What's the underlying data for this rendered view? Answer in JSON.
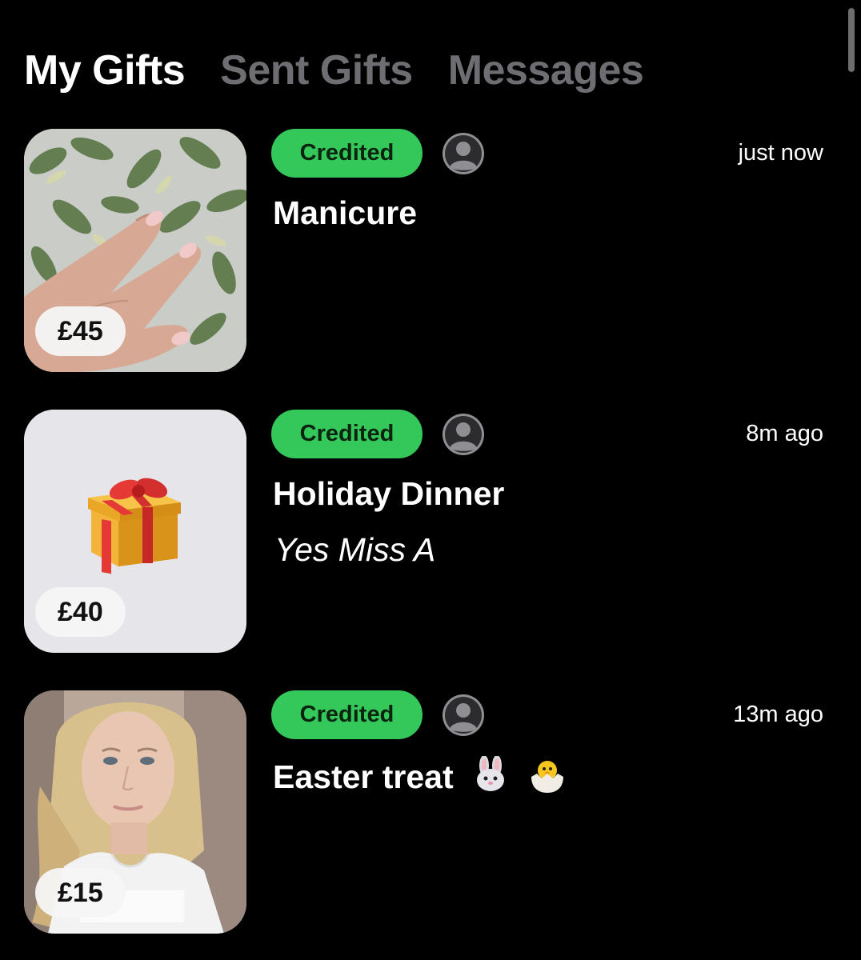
{
  "tabs": [
    {
      "label": "My Gifts",
      "active": true
    },
    {
      "label": "Sent Gifts",
      "active": false
    },
    {
      "label": "Messages",
      "active": false
    }
  ],
  "colors": {
    "background": "#000000",
    "badge": "#34c759",
    "inactive_tab": "#6e6e72"
  },
  "gifts": [
    {
      "price": "£45",
      "status": "Credited",
      "time": "just now",
      "title": "Manicure",
      "message": "",
      "image": "manicure-photo",
      "sender_icon": "person-circle-icon"
    },
    {
      "price": "£40",
      "status": "Credited",
      "time": "8m ago",
      "title": "Holiday Dinner",
      "message": "Yes Miss A",
      "image": "gift-box-icon",
      "sender_icon": "person-circle-icon"
    },
    {
      "price": "£15",
      "status": "Credited",
      "time": "13m ago",
      "title": "Easter treat",
      "message": "",
      "image": "selfie-photo",
      "title_emojis": [
        "rabbit-face-icon",
        "hatching-chick-icon"
      ],
      "sender_icon": "person-circle-icon"
    }
  ]
}
